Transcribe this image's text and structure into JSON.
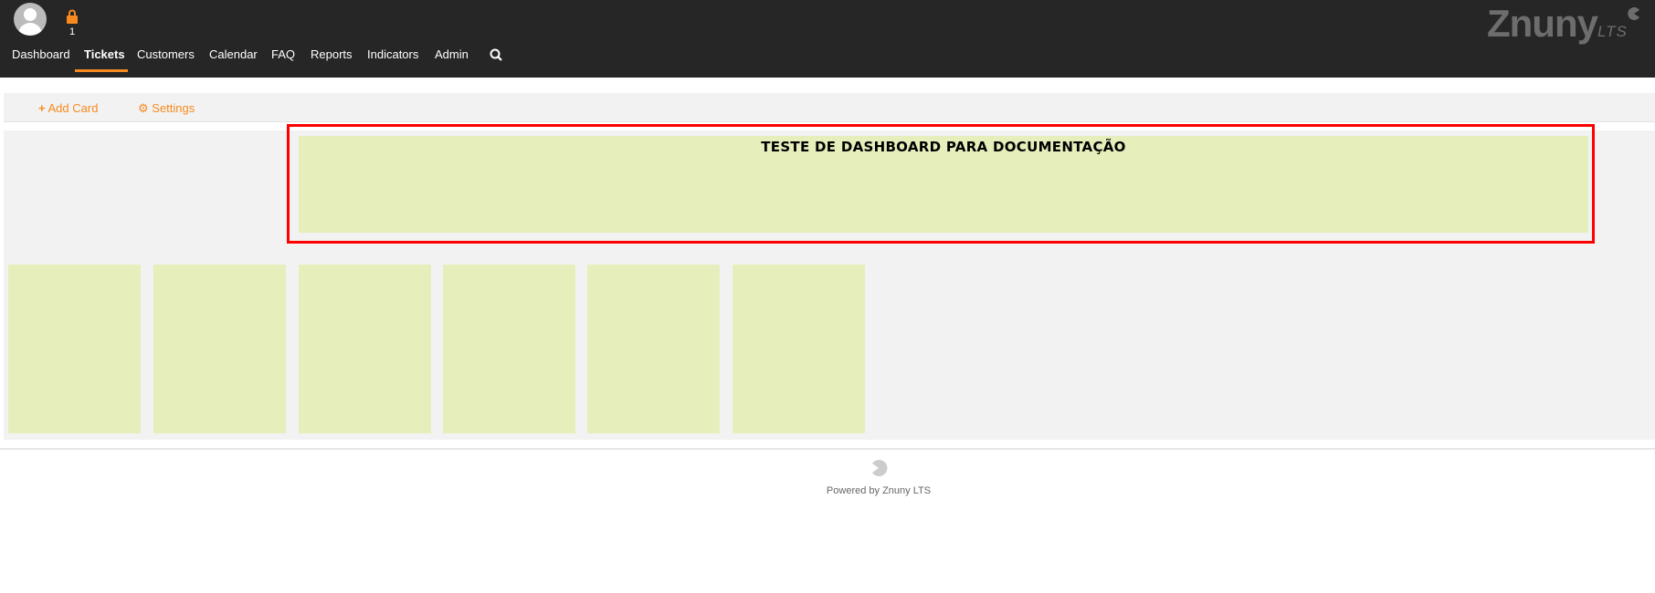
{
  "header": {
    "lock_count": "1",
    "nav": [
      {
        "label": "Dashboard"
      },
      {
        "label": "Tickets",
        "active": true
      },
      {
        "label": "Customers"
      },
      {
        "label": "Calendar"
      },
      {
        "label": "FAQ"
      },
      {
        "label": "Reports"
      },
      {
        "label": "Indicators"
      },
      {
        "label": "Admin"
      }
    ],
    "logo": "Znuny",
    "logo_suffix": "LTS"
  },
  "toolbar": {
    "add_card": "Add Card",
    "settings": "Settings"
  },
  "dashboard": {
    "banner_title": "TESTE DE DASHBOARD PARA DOCUMENTAÇÃO",
    "cards": 6
  },
  "footer": {
    "powered": "Powered by Znuny LTS"
  },
  "colors": {
    "accent": "#f68a1f",
    "header": "#262626",
    "card": "#e6efbb",
    "highlight": "#ff0000"
  }
}
